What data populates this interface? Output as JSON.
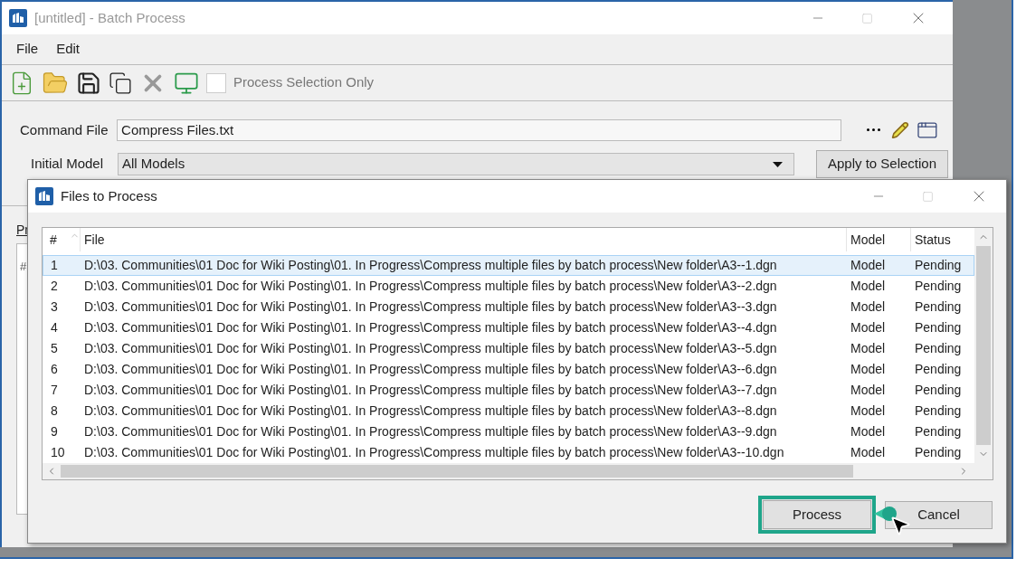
{
  "window": {
    "title": "[untitled] - Batch Process"
  },
  "menu": [
    {
      "label": "File"
    },
    {
      "label": "Edit"
    }
  ],
  "toolbar": {
    "process_selection_only": {
      "label": "Process Selection Only",
      "checked": false
    }
  },
  "command_file": {
    "label": "Command File",
    "value": "Compress Files.txt"
  },
  "initial_model": {
    "label": "Initial Model",
    "value": "All Models"
  },
  "apply_button": "Apply to Selection",
  "background_panel": {
    "label": "Pr",
    "column_1": "#"
  },
  "dialog": {
    "title": "Files to Process",
    "columns": [
      "#",
      "File",
      "Model",
      "Status"
    ],
    "rows": [
      {
        "number": "1",
        "file": "D:\\03. Communities\\01 Doc for Wiki Posting\\01. In Progress\\Compress multiple files by batch process\\New folder\\A3--1.dgn",
        "model": "Model",
        "status": "Pending",
        "selected": true
      },
      {
        "number": "2",
        "file": "D:\\03. Communities\\01 Doc for Wiki Posting\\01. In Progress\\Compress multiple files by batch process\\New folder\\A3--2.dgn",
        "model": "Model",
        "status": "Pending",
        "selected": false
      },
      {
        "number": "3",
        "file": "D:\\03. Communities\\01 Doc for Wiki Posting\\01. In Progress\\Compress multiple files by batch process\\New folder\\A3--3.dgn",
        "model": "Model",
        "status": "Pending",
        "selected": false
      },
      {
        "number": "4",
        "file": "D:\\03. Communities\\01 Doc for Wiki Posting\\01. In Progress\\Compress multiple files by batch process\\New folder\\A3--4.dgn",
        "model": "Model",
        "status": "Pending",
        "selected": false
      },
      {
        "number": "5",
        "file": "D:\\03. Communities\\01 Doc for Wiki Posting\\01. In Progress\\Compress multiple files by batch process\\New folder\\A3--5.dgn",
        "model": "Model",
        "status": "Pending",
        "selected": false
      },
      {
        "number": "6",
        "file": "D:\\03. Communities\\01 Doc for Wiki Posting\\01. In Progress\\Compress multiple files by batch process\\New folder\\A3--6.dgn",
        "model": "Model",
        "status": "Pending",
        "selected": false
      },
      {
        "number": "7",
        "file": "D:\\03. Communities\\01 Doc for Wiki Posting\\01. In Progress\\Compress multiple files by batch process\\New folder\\A3--7.dgn",
        "model": "Model",
        "status": "Pending",
        "selected": false
      },
      {
        "number": "8",
        "file": "D:\\03. Communities\\01 Doc for Wiki Posting\\01. In Progress\\Compress multiple files by batch process\\New folder\\A3--8.dgn",
        "model": "Model",
        "status": "Pending",
        "selected": false
      },
      {
        "number": "9",
        "file": "D:\\03. Communities\\01 Doc for Wiki Posting\\01. In Progress\\Compress multiple files by batch process\\New folder\\A3--9.dgn",
        "model": "Model",
        "status": "Pending",
        "selected": false
      },
      {
        "number": "10",
        "file": "D:\\03. Communities\\01 Doc for Wiki Posting\\01. In Progress\\Compress multiple files by batch process\\New folder\\A3--10.dgn",
        "model": "Model",
        "status": "Pending",
        "selected": false
      }
    ],
    "buttons": [
      {
        "label": "Process",
        "highlighted": true
      },
      {
        "label": "Cancel",
        "highlighted": false
      }
    ]
  }
}
